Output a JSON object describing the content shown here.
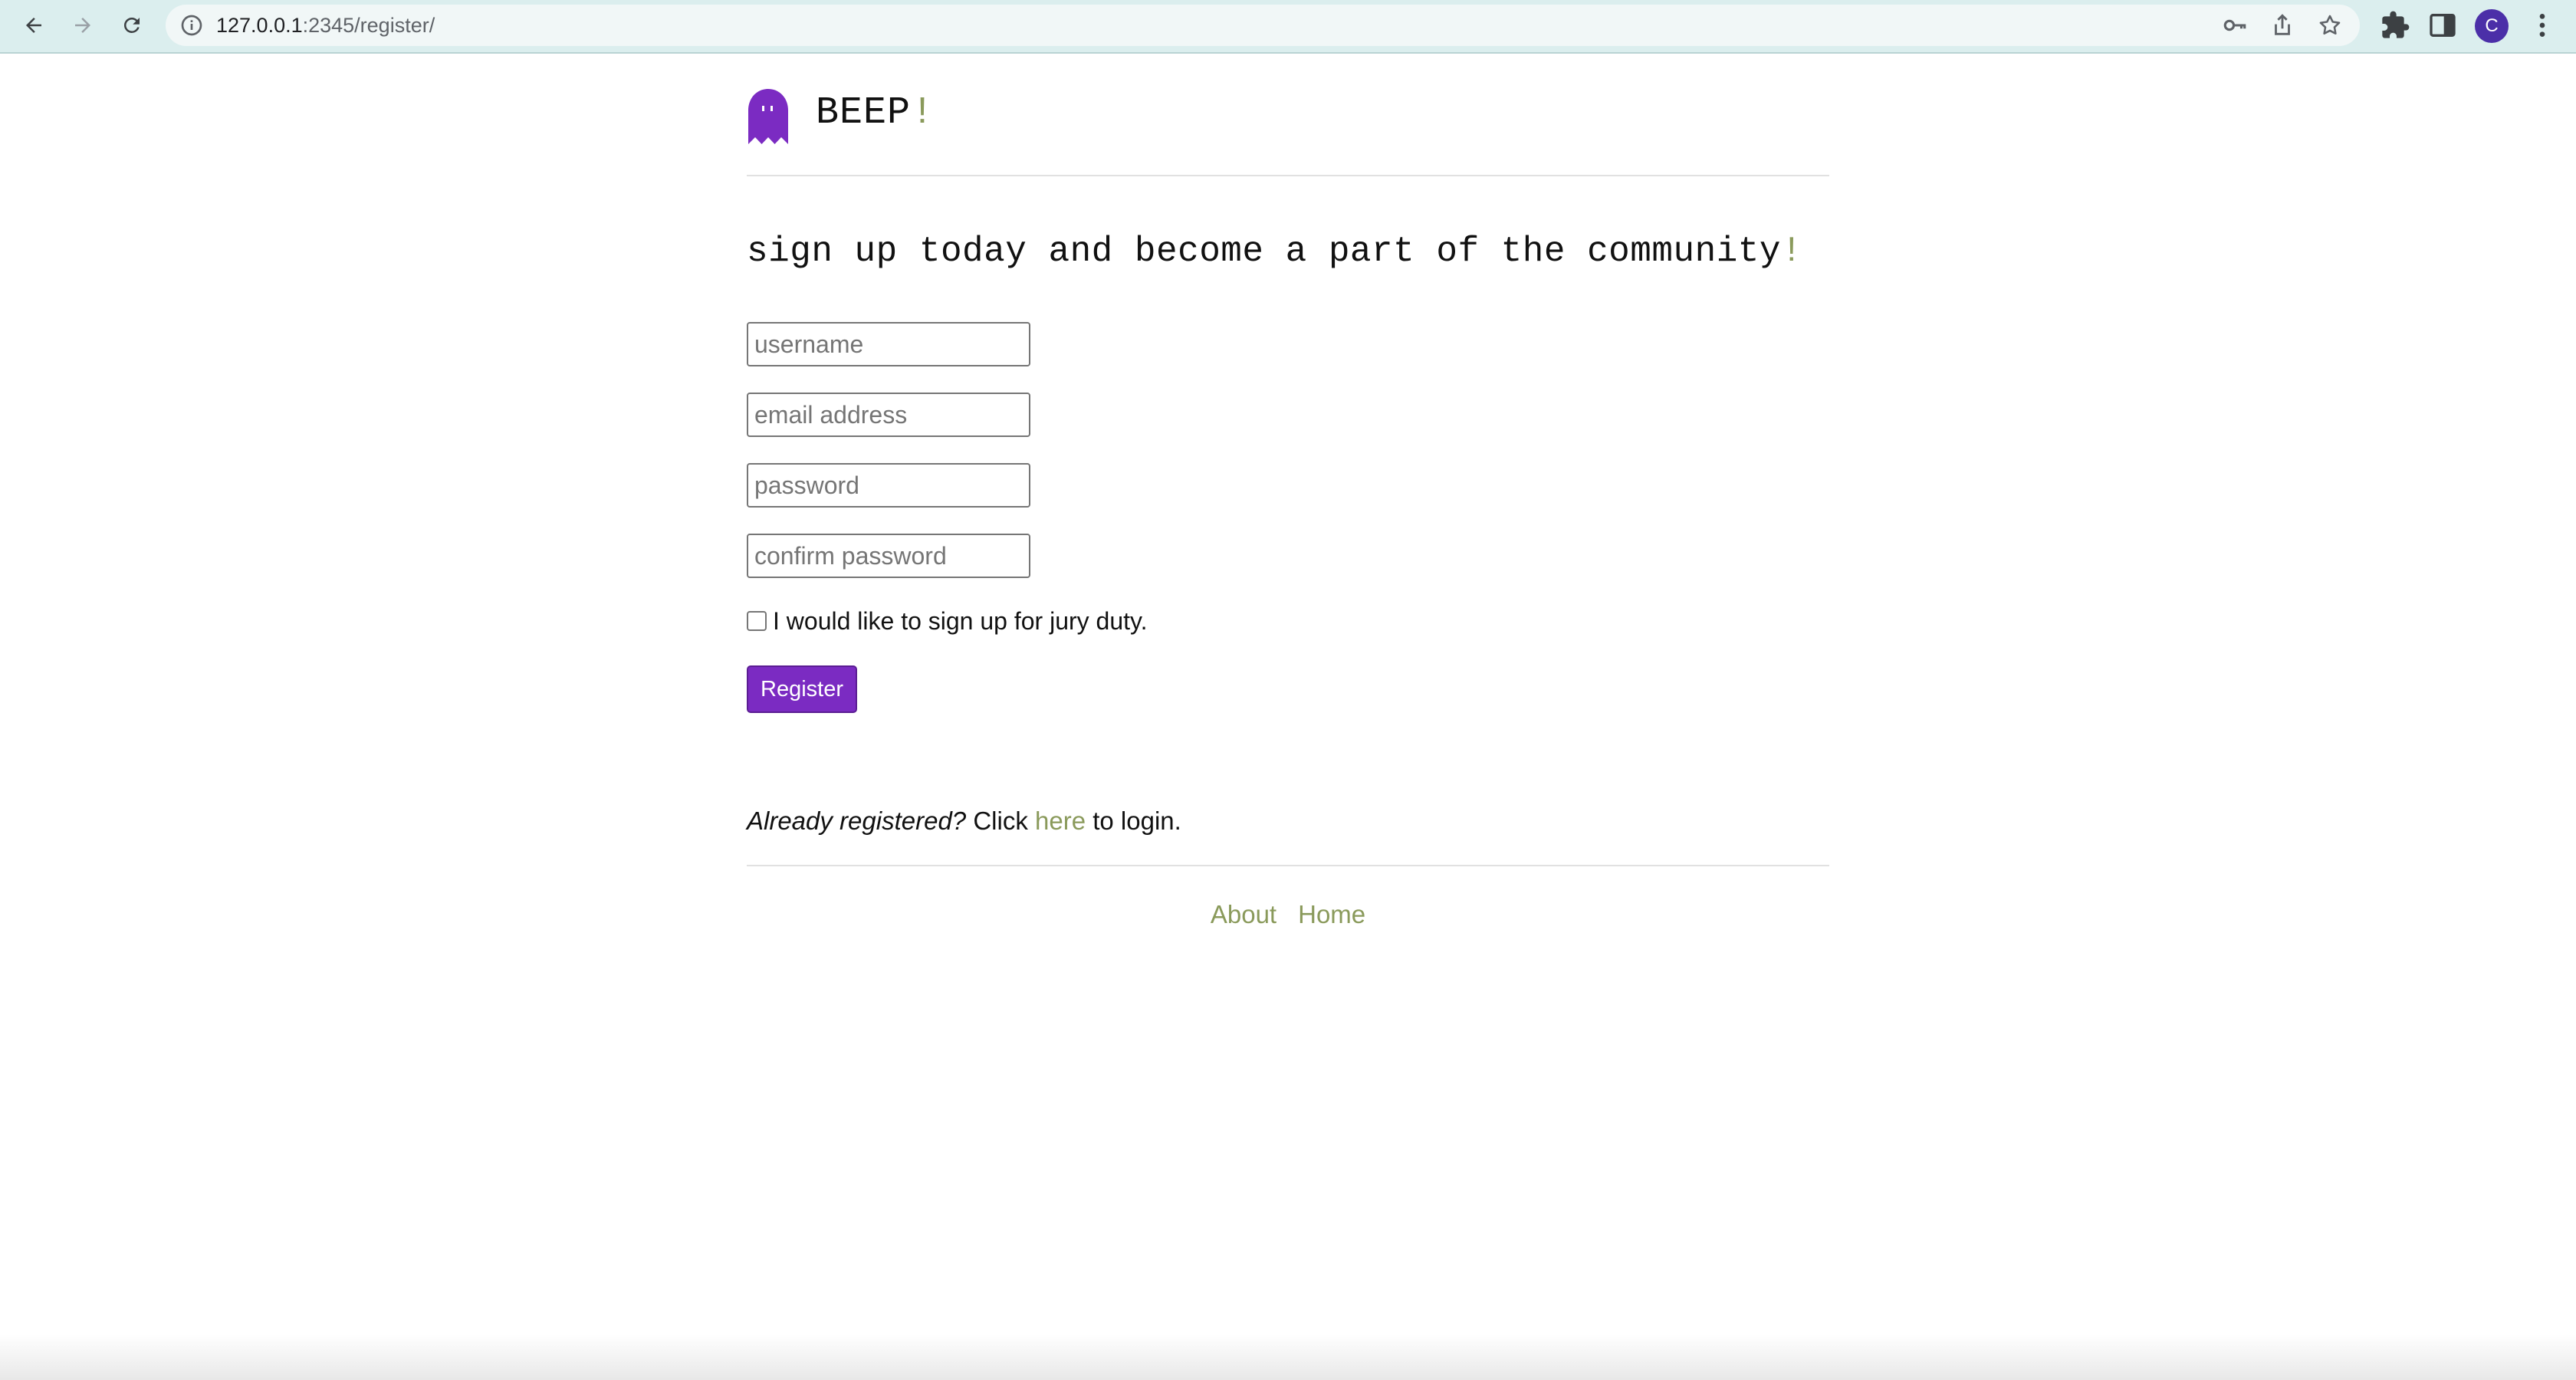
{
  "browser": {
    "url_host": "127.0.0.1",
    "url_rest": ":2345/register/",
    "profile_initial": "C",
    "icons": {
      "back": "arrow-left-icon",
      "forward": "arrow-right-icon",
      "reload": "reload-icon",
      "site_info": "info-icon",
      "password": "key-icon",
      "share": "share-icon",
      "bookmark": "star-icon",
      "extensions": "puzzle-icon",
      "side_panel": "side-panel-icon",
      "menu": "kebab-menu-icon"
    }
  },
  "header": {
    "brand": "BEEP",
    "brand_bang": "!",
    "logo_icon": "ghost-icon",
    "logo_color": "#7b2bc2"
  },
  "page": {
    "headline": "sign up today and become a part of the community",
    "headline_bang": "!"
  },
  "form": {
    "username_placeholder": "username",
    "email_placeholder": "email address",
    "password_placeholder": "password",
    "confirm_placeholder": "confirm password",
    "jury_label": "I would like to sign up for jury duty.",
    "register_label": "Register"
  },
  "login_prompt": {
    "question": "Already registered?",
    "click": "Click",
    "link": "here",
    "suffix": "to login."
  },
  "footer": {
    "links": [
      "About",
      "Home"
    ]
  },
  "colors": {
    "accent": "#8a9a5b",
    "primary": "#7b2bc2"
  }
}
